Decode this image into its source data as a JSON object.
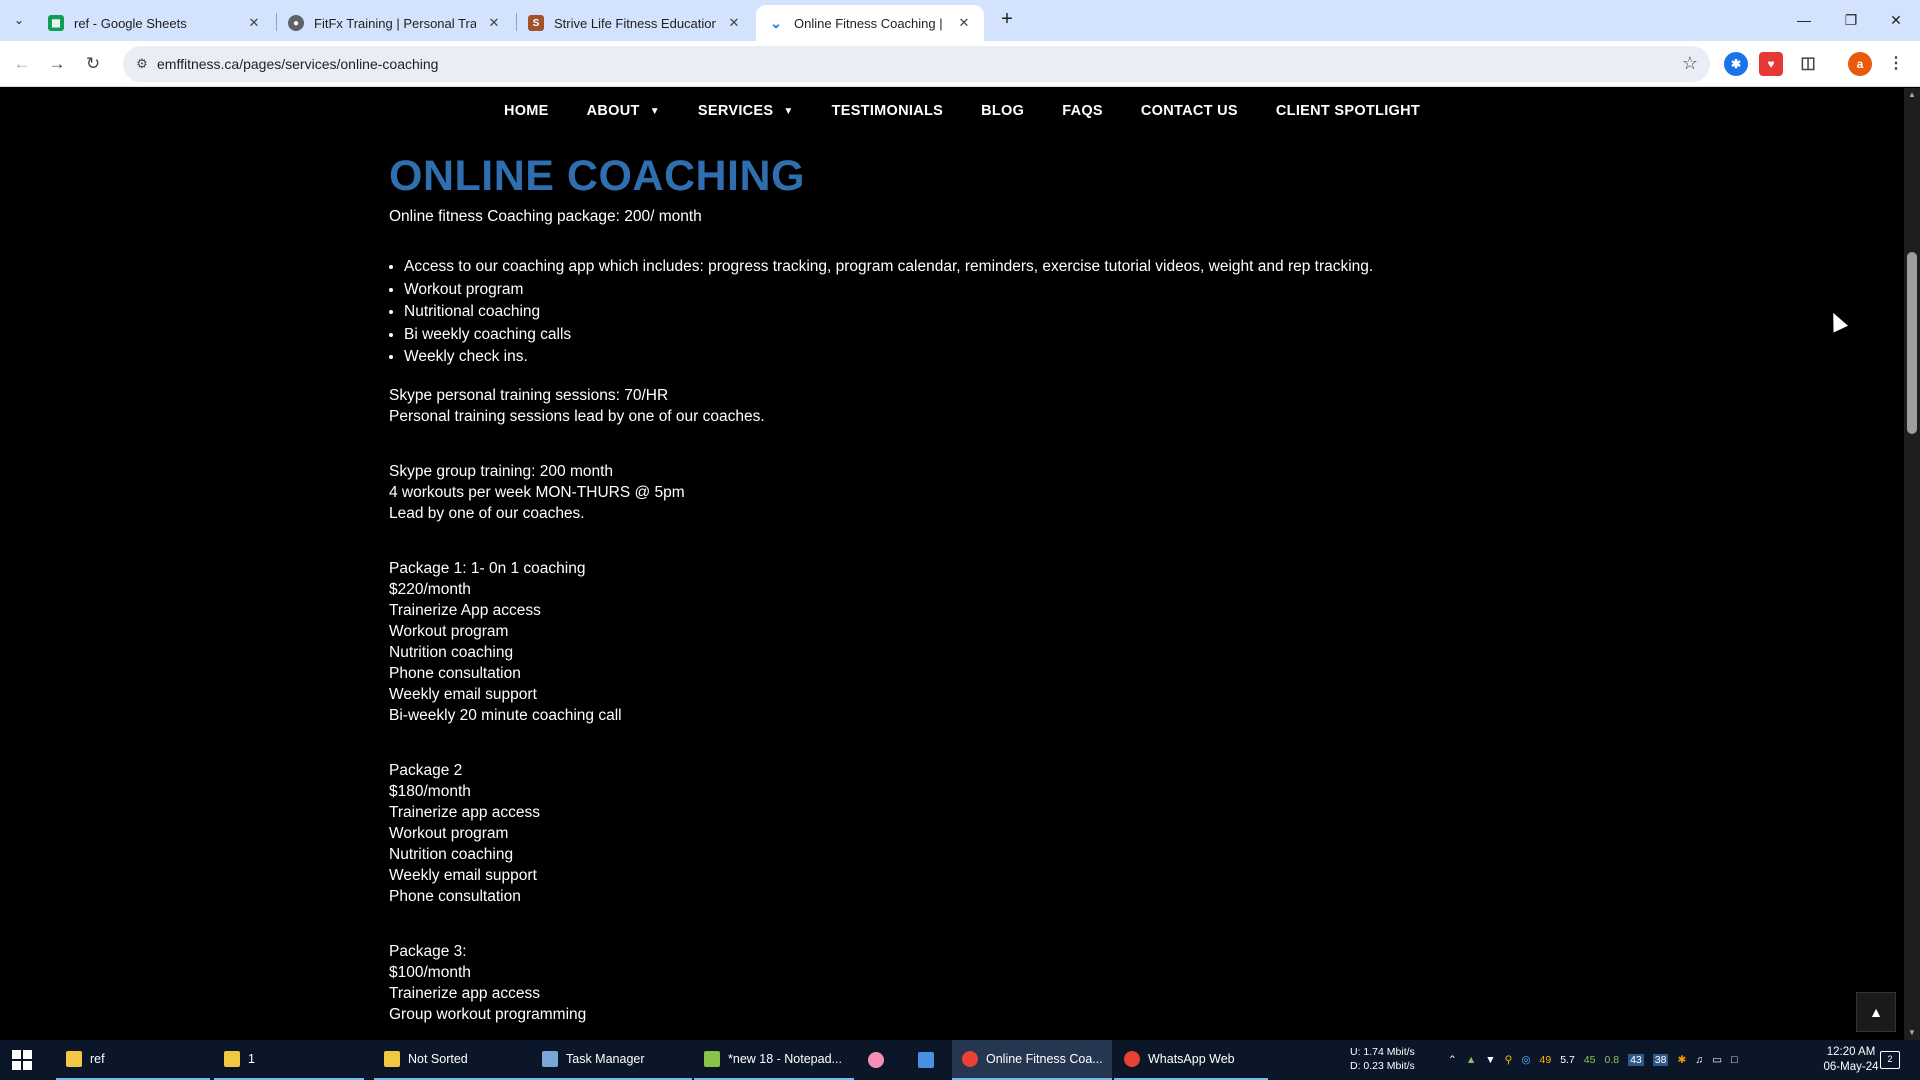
{
  "browser": {
    "tabs": [
      {
        "title": "ref - Google Sheets",
        "icon": "google-sheets-icon",
        "color": "#0f9d58",
        "active": false
      },
      {
        "title": "FitFx Training | Personal Training",
        "icon": "globe-icon",
        "color": "#5f6368",
        "active": false
      },
      {
        "title": "Strive Life Fitness Education | O",
        "icon": "strive-icon",
        "color": "#a0522d",
        "active": false
      },
      {
        "title": "Online Fitness Coaching | Skype",
        "icon": "loading-icon",
        "color": "#1a73e8",
        "active": true
      }
    ],
    "url": "emffitness.ca/pages/services/online-coaching",
    "profile_initial": "a"
  },
  "site_nav": {
    "items": [
      {
        "label": "HOME",
        "dropdown": false
      },
      {
        "label": "ABOUT",
        "dropdown": true
      },
      {
        "label": "SERVICES",
        "dropdown": true
      },
      {
        "label": "TESTIMONIALS",
        "dropdown": false
      },
      {
        "label": "BLOG",
        "dropdown": false
      },
      {
        "label": "FAQS",
        "dropdown": false
      },
      {
        "label": "CONTACT US",
        "dropdown": false
      },
      {
        "label": "CLIENT SPOTLIGHT",
        "dropdown": false
      }
    ]
  },
  "page": {
    "title": "ONLINE COACHING",
    "intro": "Online fitness Coaching package: 200/ month",
    "features": [
      "Access to our coaching app which includes: progress tracking, program calendar, reminders, exercise tutorial videos, weight and rep tracking.",
      "Workout program",
      "Nutritional coaching",
      "Bi weekly coaching calls",
      "Weekly check ins."
    ],
    "skype_personal": [
      "Skype personal training sessions: 70/HR",
      "Personal training sessions lead by one of our coaches."
    ],
    "skype_group": [
      "Skype group training: 200 month",
      "4 workouts per week MON-THURS @ 5pm",
      "Lead by one of our coaches."
    ],
    "package1": [
      "Package 1: 1- 0n 1 coaching",
      "$220/month",
      "Trainerize App access",
      "Workout program",
      "Nutrition coaching",
      "Phone consultation",
      "Weekly email support",
      "Bi-weekly 20 minute coaching call"
    ],
    "package2": [
      "Package 2",
      "$180/month",
      "Trainerize app access",
      "Workout program",
      "Nutrition coaching",
      "Weekly email support",
      "Phone consultation"
    ],
    "package3": [
      "Package 3:",
      "$100/month",
      "Trainerize app access",
      "Group workout programming"
    ],
    "title_color": "#2f6fb0"
  },
  "taskbar": {
    "items": [
      {
        "label": "ref",
        "icon": "folder-icon",
        "color": "#f2c744"
      },
      {
        "label": "1",
        "icon": "folder-icon",
        "color": "#f2c744"
      },
      {
        "label": "Not Sorted",
        "icon": "folder-icon",
        "color": "#f2c744"
      },
      {
        "label": "Task Manager",
        "icon": "task-manager-icon",
        "color": "#7aa7d8"
      },
      {
        "label": "*new 18 - Notepad...",
        "icon": "notepad-plus-icon",
        "color": "#8bc34a"
      },
      {
        "label": "",
        "icon": "app-icon",
        "color": "#f48fb1"
      },
      {
        "label": "",
        "icon": "document-icon",
        "color": "#4a90e2"
      },
      {
        "label": "Online Fitness Coa...",
        "icon": "chrome-icon",
        "color": "#e94235"
      },
      {
        "label": "WhatsApp Web",
        "icon": "chrome-icon",
        "color": "#e94235"
      }
    ],
    "net_up": "U:  1.74 Mbit/s",
    "net_down": "D:  0.23 Mbit/s",
    "tray_numbers": [
      "49",
      "5.7",
      "45",
      "0.8"
    ],
    "tray_badges": [
      "43",
      "38"
    ],
    "time": "12:20 AM",
    "date": "06-May-24",
    "notifications": "2"
  }
}
